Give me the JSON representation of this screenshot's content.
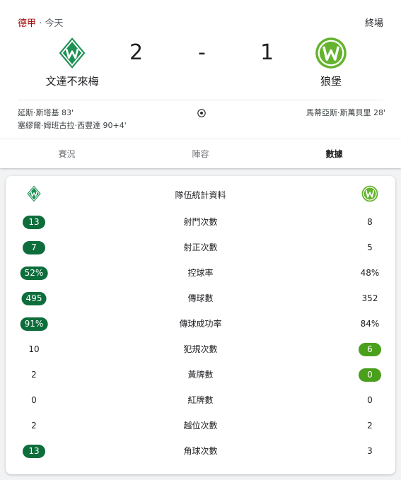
{
  "header": {
    "league": "德甲",
    "separator": "·",
    "date": "今天",
    "status": "終場"
  },
  "match": {
    "home": {
      "name": "文達不來梅",
      "score": "2",
      "logo_icon": "werder-bremen-logo-icon",
      "color": "#1d9053"
    },
    "away": {
      "name": "狼堡",
      "score": "1",
      "logo_icon": "vfl-wolfsburg-logo-icon",
      "color": "#65b32e"
    },
    "dash": "-"
  },
  "scorers": {
    "home": [
      "延斯·斯塔基 83'",
      "塞繆爾·姆班古拉·西豐達 90+4'"
    ],
    "away": [
      "馬蒂亞斯·斯萬貝里 28'"
    ],
    "icon": "soccer-ball-icon"
  },
  "tabs": [
    {
      "label": "賽況",
      "active": false
    },
    {
      "label": "陣容",
      "active": false
    },
    {
      "label": "數據",
      "active": true
    }
  ],
  "stats": {
    "title": "隊伍統計資料",
    "rows": [
      {
        "label": "射門次數",
        "home": "13",
        "away": "8",
        "highlight": "home"
      },
      {
        "label": "射正次數",
        "home": "7",
        "away": "5",
        "highlight": "home"
      },
      {
        "label": "控球率",
        "home": "52%",
        "away": "48%",
        "highlight": "home"
      },
      {
        "label": "傳球數",
        "home": "495",
        "away": "352",
        "highlight": "home"
      },
      {
        "label": "傳球成功率",
        "home": "91%",
        "away": "84%",
        "highlight": "home"
      },
      {
        "label": "犯規次數",
        "home": "10",
        "away": "6",
        "highlight": "away"
      },
      {
        "label": "黃牌數",
        "home": "2",
        "away": "0",
        "highlight": "away"
      },
      {
        "label": "紅牌數",
        "home": "0",
        "away": "0",
        "highlight": "none"
      },
      {
        "label": "越位次數",
        "home": "2",
        "away": "2",
        "highlight": "none"
      },
      {
        "label": "角球次數",
        "home": "13",
        "away": "3",
        "highlight": "home"
      }
    ]
  }
}
